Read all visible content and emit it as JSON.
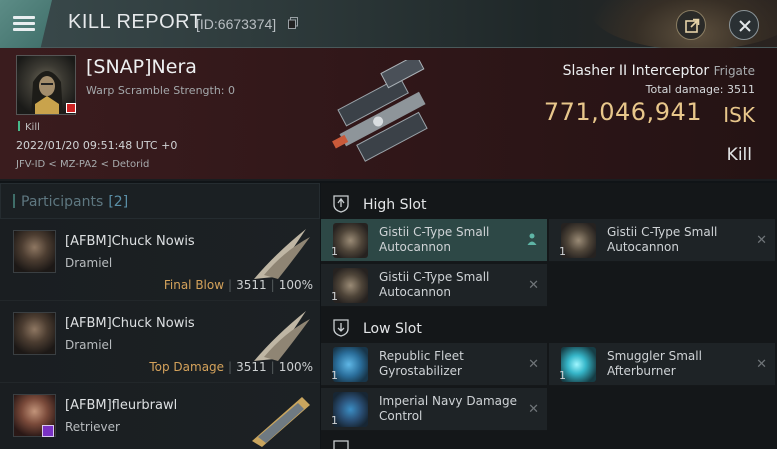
{
  "header": {
    "title": "KILL REPORT",
    "kill_id": "[ID:6673374]"
  },
  "victim": {
    "name": "[SNAP]Nera",
    "subtitle": "Warp Scramble Strength: 0",
    "kill_tag": "Kill",
    "time": "2022/01/20 09:51:48 UTC +0",
    "location": "JFV-ID < MZ-PA2 < Detorid",
    "ship_name": "Slasher II Interceptor",
    "ship_class": "Frigate",
    "total_damage_label": "Total damage:",
    "total_damage": "3511",
    "isk_value": "771,046,941",
    "isk_unit": "ISK",
    "result_label": "Kill"
  },
  "participants": {
    "title": "Participants",
    "count": "[2]",
    "rows": [
      {
        "name": "[AFBM]Chuck Nowis",
        "ship": "Dramiel",
        "tag": "Final Blow",
        "damage": "3511",
        "percent": "100%"
      },
      {
        "name": "[AFBM]Chuck Nowis",
        "ship": "Dramiel",
        "tag": "Top Damage",
        "damage": "3511",
        "percent": "100%"
      },
      {
        "name": "[AFBM]fleurbrawl",
        "ship": "Retriever",
        "tag": "",
        "damage": "",
        "percent": ""
      }
    ]
  },
  "fitting": {
    "high_slot": {
      "title": "High Slot",
      "modules": [
        {
          "name": "Gistii C-Type Small Autocannon",
          "qty": "1"
        },
        {
          "name": "Gistii C-Type Small Autocannon",
          "qty": "1"
        },
        {
          "name": "Gistii C-Type Small Autocannon",
          "qty": "1"
        }
      ]
    },
    "low_slot": {
      "title": "Low Slot",
      "modules": [
        {
          "name": "Republic Fleet Gyrostabilizer",
          "qty": "1"
        },
        {
          "name": "Smuggler Small Afterburner",
          "qty": "1"
        },
        {
          "name": "Imperial Navy Damage Control",
          "qty": "1"
        }
      ]
    }
  },
  "colors": {
    "accent": "#3f6e69",
    "isk": "#e8c78b",
    "final_blow": "#d4a25b",
    "victim_bg": "#3a1c1e"
  }
}
